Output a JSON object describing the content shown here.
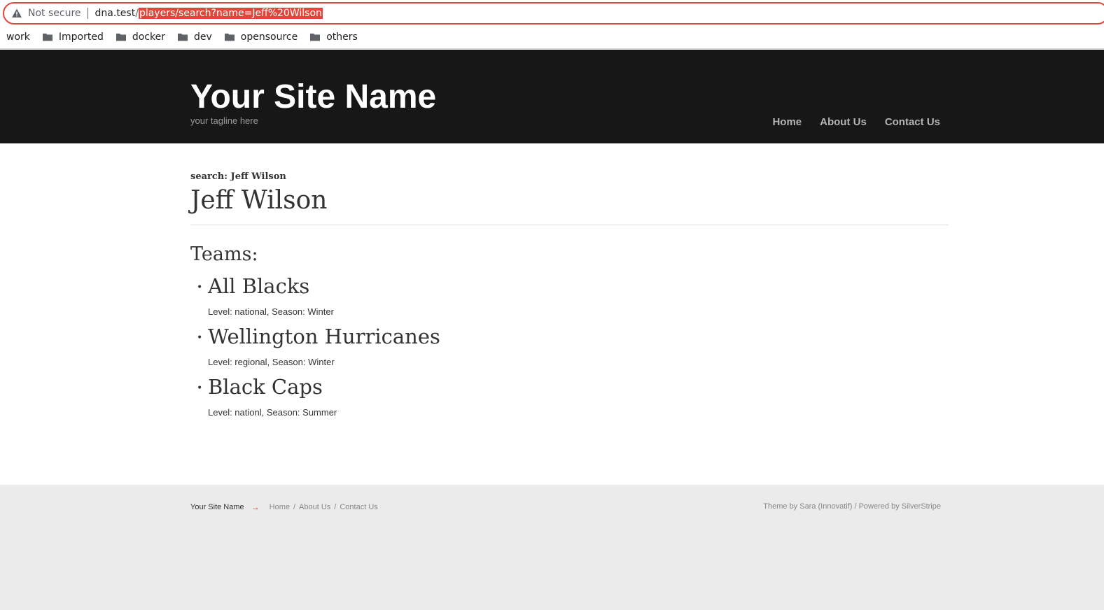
{
  "browser": {
    "security_label": "Not secure",
    "url_host": "dna.test",
    "url_slash": "/",
    "url_path": "players/search?name=Jeff%20Wilson",
    "bookmarks": [
      {
        "label": "work",
        "icon": "none"
      },
      {
        "label": "Imported",
        "icon": "folder-icon"
      },
      {
        "label": "docker",
        "icon": "folder-icon"
      },
      {
        "label": "dev",
        "icon": "folder-icon"
      },
      {
        "label": "opensource",
        "icon": "folder-icon"
      },
      {
        "label": "others",
        "icon": "folder-icon"
      }
    ]
  },
  "header": {
    "site_name": "Your Site Name",
    "tagline": "your tagline here",
    "nav": [
      "Home",
      "About Us",
      "Contact Us"
    ]
  },
  "main": {
    "breadcrumb": "search: Jeff Wilson",
    "title": "Jeff Wilson",
    "teams_heading": "Teams:",
    "teams": [
      {
        "name": "All Blacks",
        "meta": "Level: national, Season: Winter"
      },
      {
        "name": "Wellington Hurricanes",
        "meta": "Level: regional, Season: Winter"
      },
      {
        "name": "Black Caps",
        "meta": "Level: nationl, Season: Summer"
      }
    ]
  },
  "footer": {
    "site_name": "Your Site Name",
    "arrow": "→",
    "links": [
      "Home",
      "About Us",
      "Contact Us"
    ],
    "link_divider": "/",
    "credits": "Theme by Sara (Innovatif) / Powered by SilverStripe"
  },
  "colors": {
    "header_bg": "#171717",
    "footer_bg": "#ebebeb",
    "url_highlight": "#e0473a"
  }
}
